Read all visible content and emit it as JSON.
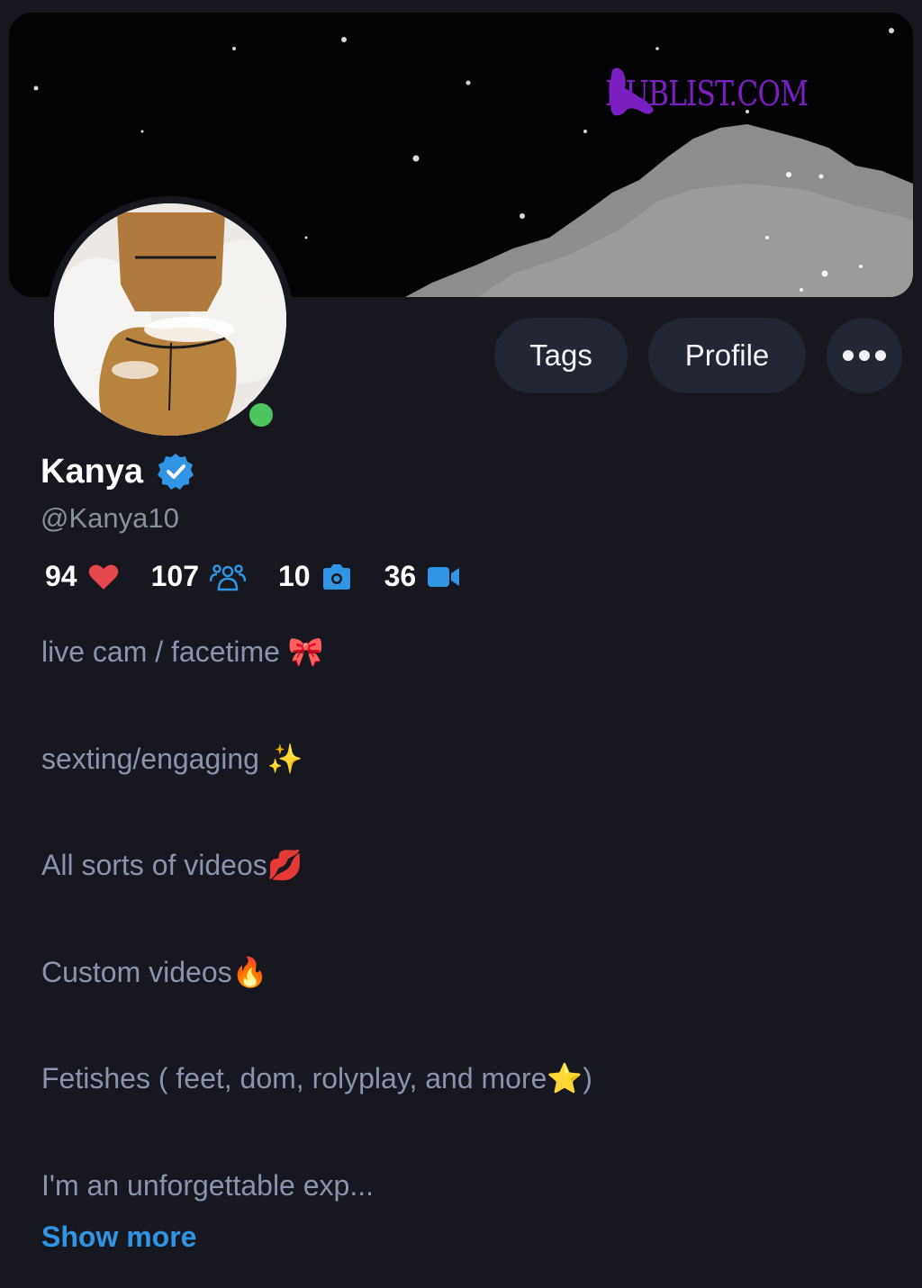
{
  "watermark": {
    "text": "RUBLIST.COM"
  },
  "profile": {
    "name": "Kanya",
    "handle": "@Kanya10",
    "online": true
  },
  "actions": {
    "tags_label": "Tags",
    "profile_label": "Profile"
  },
  "stats": [
    {
      "value": "94",
      "icon": "heart-icon"
    },
    {
      "value": "107",
      "icon": "followers-icon"
    },
    {
      "value": "10",
      "icon": "camera-icon"
    },
    {
      "value": "36",
      "icon": "video-icon"
    }
  ],
  "bio": {
    "lines": [
      "live cam / facetime 🎀",
      "sexting/engaging ✨",
      "All sorts of videos💋",
      "Custom videos🔥",
      "Fetishes ( feet, dom, rolyplay, and more⭐)",
      "I'm an unforgettable exp..."
    ],
    "show_more_label": "Show more"
  },
  "colors": {
    "background": "#17181f",
    "button": "#232733",
    "accent_blue": "#2f95e4",
    "online_green": "#4cc55e",
    "heart_red": "#e5484d",
    "bio_text": "#8b93ad",
    "watermark": "#7b1fc2"
  }
}
